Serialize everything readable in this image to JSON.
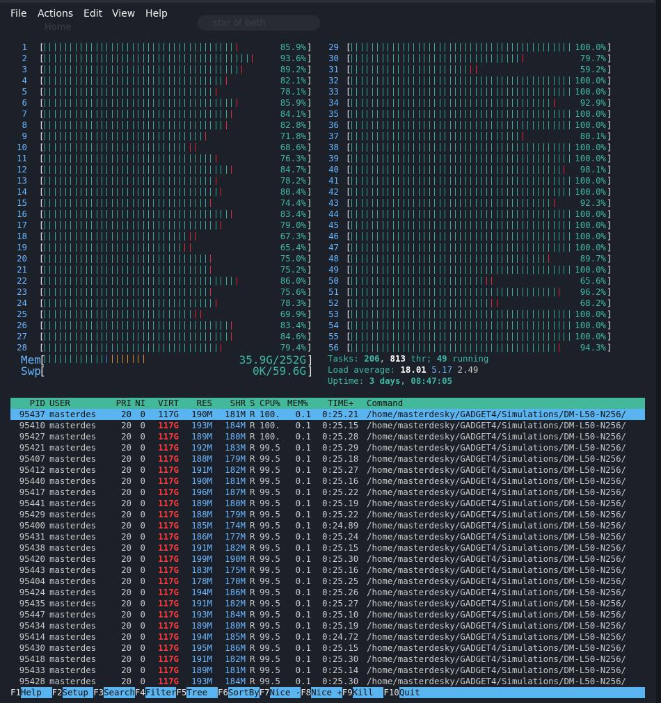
{
  "menu": {
    "items": [
      "File",
      "Actions",
      "Edit",
      "View",
      "Help"
    ]
  },
  "background": {
    "home": "Home",
    "search": "star of beth"
  },
  "cpus_left": [
    {
      "n": "1",
      "pct": "85.9%"
    },
    {
      "n": "2",
      "pct": "93.6%"
    },
    {
      "n": "3",
      "pct": "89.2%"
    },
    {
      "n": "4",
      "pct": "82.1%"
    },
    {
      "n": "5",
      "pct": "78.1%"
    },
    {
      "n": "6",
      "pct": "85.9%"
    },
    {
      "n": "7",
      "pct": "84.1%"
    },
    {
      "n": "8",
      "pct": "82.8%"
    },
    {
      "n": "9",
      "pct": "71.8%"
    },
    {
      "n": "10",
      "pct": "68.6%"
    },
    {
      "n": "11",
      "pct": "76.3%"
    },
    {
      "n": "12",
      "pct": "84.7%"
    },
    {
      "n": "13",
      "pct": "78.2%"
    },
    {
      "n": "14",
      "pct": "80.4%"
    },
    {
      "n": "15",
      "pct": "74.4%"
    },
    {
      "n": "16",
      "pct": "83.4%"
    },
    {
      "n": "17",
      "pct": "79.0%"
    },
    {
      "n": "18",
      "pct": "67.3%"
    },
    {
      "n": "19",
      "pct": "65.4%"
    },
    {
      "n": "20",
      "pct": "75.0%"
    },
    {
      "n": "21",
      "pct": "75.2%"
    },
    {
      "n": "22",
      "pct": "86.0%"
    },
    {
      "n": "23",
      "pct": "75.6%"
    },
    {
      "n": "24",
      "pct": "78.3%"
    },
    {
      "n": "25",
      "pct": "69.9%"
    },
    {
      "n": "26",
      "pct": "83.4%"
    },
    {
      "n": "27",
      "pct": "84.6%"
    },
    {
      "n": "28",
      "pct": "79.4%"
    }
  ],
  "cpus_right": [
    {
      "n": "29",
      "pct": "100.0%"
    },
    {
      "n": "30",
      "pct": "79.7%"
    },
    {
      "n": "31",
      "pct": "59.2%"
    },
    {
      "n": "32",
      "pct": "100.0%"
    },
    {
      "n": "33",
      "pct": "100.0%"
    },
    {
      "n": "34",
      "pct": "92.9%"
    },
    {
      "n": "35",
      "pct": "100.0%"
    },
    {
      "n": "36",
      "pct": "100.0%"
    },
    {
      "n": "37",
      "pct": "80.1%"
    },
    {
      "n": "38",
      "pct": "100.0%"
    },
    {
      "n": "39",
      "pct": "100.0%"
    },
    {
      "n": "40",
      "pct": "98.1%"
    },
    {
      "n": "41",
      "pct": "100.0%"
    },
    {
      "n": "42",
      "pct": "100.0%"
    },
    {
      "n": "43",
      "pct": "92.3%"
    },
    {
      "n": "44",
      "pct": "100.0%"
    },
    {
      "n": "45",
      "pct": "100.0%"
    },
    {
      "n": "46",
      "pct": "100.0%"
    },
    {
      "n": "47",
      "pct": "100.0%"
    },
    {
      "n": "48",
      "pct": "89.7%"
    },
    {
      "n": "49",
      "pct": "100.0%"
    },
    {
      "n": "50",
      "pct": "65.6%"
    },
    {
      "n": "51",
      "pct": "96.2%"
    },
    {
      "n": "52",
      "pct": "68.2%"
    },
    {
      "n": "53",
      "pct": "100.0%"
    },
    {
      "n": "54",
      "pct": "100.0%"
    },
    {
      "n": "55",
      "pct": "100.0%"
    },
    {
      "n": "56",
      "pct": "94.3%"
    }
  ],
  "memory": {
    "mem_label": "Mem",
    "mem_value": "35.9G/252G",
    "swp_label": "Swp",
    "swp_value": "0K/59.6G"
  },
  "tasks": {
    "label": "Tasks:",
    "tasks": "206",
    "thr": "813",
    "thr_label": "thr;",
    "running": "49",
    "running_label": "running"
  },
  "load": {
    "label": "Load average:",
    "one": "18.01",
    "five": "5.17",
    "fifteen": "2.49"
  },
  "uptime": {
    "label": "Uptime:",
    "value": "3 days, 08:47:05"
  },
  "columns": [
    "PID",
    "USER",
    "PRI",
    "NI",
    "VIRT",
    "RES",
    "SHR",
    "S",
    "CPU%",
    "MEM%",
    "TIME+",
    "Command"
  ],
  "processes": [
    {
      "pid": "95437",
      "user": "masterdes",
      "pri": "20",
      "ni": "0",
      "virt": "117G",
      "res": "190M",
      "shr": "181M",
      "s": "R",
      "cpu": "100.",
      "mem": "0.1",
      "time": "0:25.21",
      "cmd": "/home/masterdesky/GADGET4/Simulations/DM-L50-N256/"
    },
    {
      "pid": "95410",
      "user": "masterdes",
      "pri": "20",
      "ni": "0",
      "virt": "117G",
      "res": "193M",
      "shr": "184M",
      "s": "R",
      "cpu": "100.",
      "mem": "0.1",
      "time": "0:25.15",
      "cmd": "/home/masterdesky/GADGET4/Simulations/DM-L50-N256/"
    },
    {
      "pid": "95427",
      "user": "masterdes",
      "pri": "20",
      "ni": "0",
      "virt": "117G",
      "res": "189M",
      "shr": "180M",
      "s": "R",
      "cpu": "100.",
      "mem": "0.1",
      "time": "0:25.28",
      "cmd": "/home/masterdesky/GADGET4/Simulations/DM-L50-N256/"
    },
    {
      "pid": "95421",
      "user": "masterdes",
      "pri": "20",
      "ni": "0",
      "virt": "117G",
      "res": "192M",
      "shr": "183M",
      "s": "R",
      "cpu": "99.5",
      "mem": "0.1",
      "time": "0:25.29",
      "cmd": "/home/masterdesky/GADGET4/Simulations/DM-L50-N256/"
    },
    {
      "pid": "95407",
      "user": "masterdes",
      "pri": "20",
      "ni": "0",
      "virt": "117G",
      "res": "188M",
      "shr": "179M",
      "s": "R",
      "cpu": "99.5",
      "mem": "0.1",
      "time": "0:25.18",
      "cmd": "/home/masterdesky/GADGET4/Simulations/DM-L50-N256/"
    },
    {
      "pid": "95412",
      "user": "masterdes",
      "pri": "20",
      "ni": "0",
      "virt": "117G",
      "res": "191M",
      "shr": "182M",
      "s": "R",
      "cpu": "99.5",
      "mem": "0.1",
      "time": "0:25.27",
      "cmd": "/home/masterdesky/GADGET4/Simulations/DM-L50-N256/"
    },
    {
      "pid": "95440",
      "user": "masterdes",
      "pri": "20",
      "ni": "0",
      "virt": "117G",
      "res": "190M",
      "shr": "181M",
      "s": "R",
      "cpu": "99.5",
      "mem": "0.1",
      "time": "0:25.16",
      "cmd": "/home/masterdesky/GADGET4/Simulations/DM-L50-N256/"
    },
    {
      "pid": "95417",
      "user": "masterdes",
      "pri": "20",
      "ni": "0",
      "virt": "117G",
      "res": "196M",
      "shr": "187M",
      "s": "R",
      "cpu": "99.5",
      "mem": "0.1",
      "time": "0:25.22",
      "cmd": "/home/masterdesky/GADGET4/Simulations/DM-L50-N256/"
    },
    {
      "pid": "95441",
      "user": "masterdes",
      "pri": "20",
      "ni": "0",
      "virt": "117G",
      "res": "189M",
      "shr": "180M",
      "s": "R",
      "cpu": "99.5",
      "mem": "0.1",
      "time": "0:25.19",
      "cmd": "/home/masterdesky/GADGET4/Simulations/DM-L50-N256/"
    },
    {
      "pid": "95429",
      "user": "masterdes",
      "pri": "20",
      "ni": "0",
      "virt": "117G",
      "res": "188M",
      "shr": "179M",
      "s": "R",
      "cpu": "99.5",
      "mem": "0.1",
      "time": "0:25.22",
      "cmd": "/home/masterdesky/GADGET4/Simulations/DM-L50-N256/"
    },
    {
      "pid": "95400",
      "user": "masterdes",
      "pri": "20",
      "ni": "0",
      "virt": "117G",
      "res": "185M",
      "shr": "174M",
      "s": "R",
      "cpu": "99.5",
      "mem": "0.1",
      "time": "0:24.89",
      "cmd": "/home/masterdesky/GADGET4/Simulations/DM-L50-N256/"
    },
    {
      "pid": "95431",
      "user": "masterdes",
      "pri": "20",
      "ni": "0",
      "virt": "117G",
      "res": "186M",
      "shr": "177M",
      "s": "R",
      "cpu": "99.5",
      "mem": "0.1",
      "time": "0:25.24",
      "cmd": "/home/masterdesky/GADGET4/Simulations/DM-L50-N256/"
    },
    {
      "pid": "95438",
      "user": "masterdes",
      "pri": "20",
      "ni": "0",
      "virt": "117G",
      "res": "191M",
      "shr": "182M",
      "s": "R",
      "cpu": "99.5",
      "mem": "0.1",
      "time": "0:25.15",
      "cmd": "/home/masterdesky/GADGET4/Simulations/DM-L50-N256/"
    },
    {
      "pid": "95420",
      "user": "masterdes",
      "pri": "20",
      "ni": "0",
      "virt": "117G",
      "res": "199M",
      "shr": "190M",
      "s": "R",
      "cpu": "99.5",
      "mem": "0.1",
      "time": "0:25.30",
      "cmd": "/home/masterdesky/GADGET4/Simulations/DM-L50-N256/"
    },
    {
      "pid": "95443",
      "user": "masterdes",
      "pri": "20",
      "ni": "0",
      "virt": "117G",
      "res": "183M",
      "shr": "175M",
      "s": "R",
      "cpu": "99.5",
      "mem": "0.1",
      "time": "0:25.16",
      "cmd": "/home/masterdesky/GADGET4/Simulations/DM-L50-N256/"
    },
    {
      "pid": "95404",
      "user": "masterdes",
      "pri": "20",
      "ni": "0",
      "virt": "117G",
      "res": "178M",
      "shr": "170M",
      "s": "R",
      "cpu": "99.5",
      "mem": "0.1",
      "time": "0:25.25",
      "cmd": "/home/masterdesky/GADGET4/Simulations/DM-L50-N256/"
    },
    {
      "pid": "95424",
      "user": "masterdes",
      "pri": "20",
      "ni": "0",
      "virt": "117G",
      "res": "194M",
      "shr": "186M",
      "s": "R",
      "cpu": "99.5",
      "mem": "0.1",
      "time": "0:25.26",
      "cmd": "/home/masterdesky/GADGET4/Simulations/DM-L50-N256/"
    },
    {
      "pid": "95435",
      "user": "masterdes",
      "pri": "20",
      "ni": "0",
      "virt": "117G",
      "res": "191M",
      "shr": "182M",
      "s": "R",
      "cpu": "99.5",
      "mem": "0.1",
      "time": "0:25.27",
      "cmd": "/home/masterdesky/GADGET4/Simulations/DM-L50-N256/"
    },
    {
      "pid": "95447",
      "user": "masterdes",
      "pri": "20",
      "ni": "0",
      "virt": "117G",
      "res": "193M",
      "shr": "184M",
      "s": "R",
      "cpu": "99.5",
      "mem": "0.1",
      "time": "0:25.10",
      "cmd": "/home/masterdesky/GADGET4/Simulations/DM-L50-N256/"
    },
    {
      "pid": "95434",
      "user": "masterdes",
      "pri": "20",
      "ni": "0",
      "virt": "117G",
      "res": "189M",
      "shr": "180M",
      "s": "R",
      "cpu": "99.5",
      "mem": "0.1",
      "time": "0:25.19",
      "cmd": "/home/masterdesky/GADGET4/Simulations/DM-L50-N256/"
    },
    {
      "pid": "95414",
      "user": "masterdes",
      "pri": "20",
      "ni": "0",
      "virt": "117G",
      "res": "194M",
      "shr": "185M",
      "s": "R",
      "cpu": "99.5",
      "mem": "0.1",
      "time": "0:24.72",
      "cmd": "/home/masterdesky/GADGET4/Simulations/DM-L50-N256/"
    },
    {
      "pid": "95430",
      "user": "masterdes",
      "pri": "20",
      "ni": "0",
      "virt": "117G",
      "res": "195M",
      "shr": "186M",
      "s": "R",
      "cpu": "99.5",
      "mem": "0.1",
      "time": "0:25.15",
      "cmd": "/home/masterdesky/GADGET4/Simulations/DM-L50-N256/"
    },
    {
      "pid": "95418",
      "user": "masterdes",
      "pri": "20",
      "ni": "0",
      "virt": "117G",
      "res": "191M",
      "shr": "182M",
      "s": "R",
      "cpu": "99.5",
      "mem": "0.1",
      "time": "0:25.30",
      "cmd": "/home/masterdesky/GADGET4/Simulations/DM-L50-N256/"
    },
    {
      "pid": "95433",
      "user": "masterdes",
      "pri": "20",
      "ni": "0",
      "virt": "117G",
      "res": "189M",
      "shr": "181M",
      "s": "R",
      "cpu": "99.5",
      "mem": "0.1",
      "time": "0:25.14",
      "cmd": "/home/masterdesky/GADGET4/Simulations/DM-L50-N256/"
    },
    {
      "pid": "95428",
      "user": "masterdes",
      "pri": "20",
      "ni": "0",
      "virt": "117G",
      "res": "193M",
      "shr": "184M",
      "s": "R",
      "cpu": "99.5",
      "mem": "0.1",
      "time": "0:25.30",
      "cmd": "/home/masterdesky/GADGET4/Simulations/DM-L50-N256/"
    }
  ],
  "footer": [
    {
      "key": "F1",
      "label": "Help  "
    },
    {
      "key": "F2",
      "label": "Setup "
    },
    {
      "key": "F3",
      "label": "Search"
    },
    {
      "key": "F4",
      "label": "Filter"
    },
    {
      "key": "F5",
      "label": "Tree  "
    },
    {
      "key": "F6",
      "label": "SortBy"
    },
    {
      "key": "F7",
      "label": "Nice -"
    },
    {
      "key": "F8",
      "label": "Nice +"
    },
    {
      "key": "F9",
      "label": "Kill  "
    },
    {
      "key": "F10",
      "label": "Quit"
    }
  ],
  "colors": {
    "bar_normal": "#3aa89a",
    "bar_kernel": "#e0283a",
    "header_bg": "#44b89a",
    "selected_bg": "#5ab4f0",
    "virt_red": "#ff3b3b"
  }
}
